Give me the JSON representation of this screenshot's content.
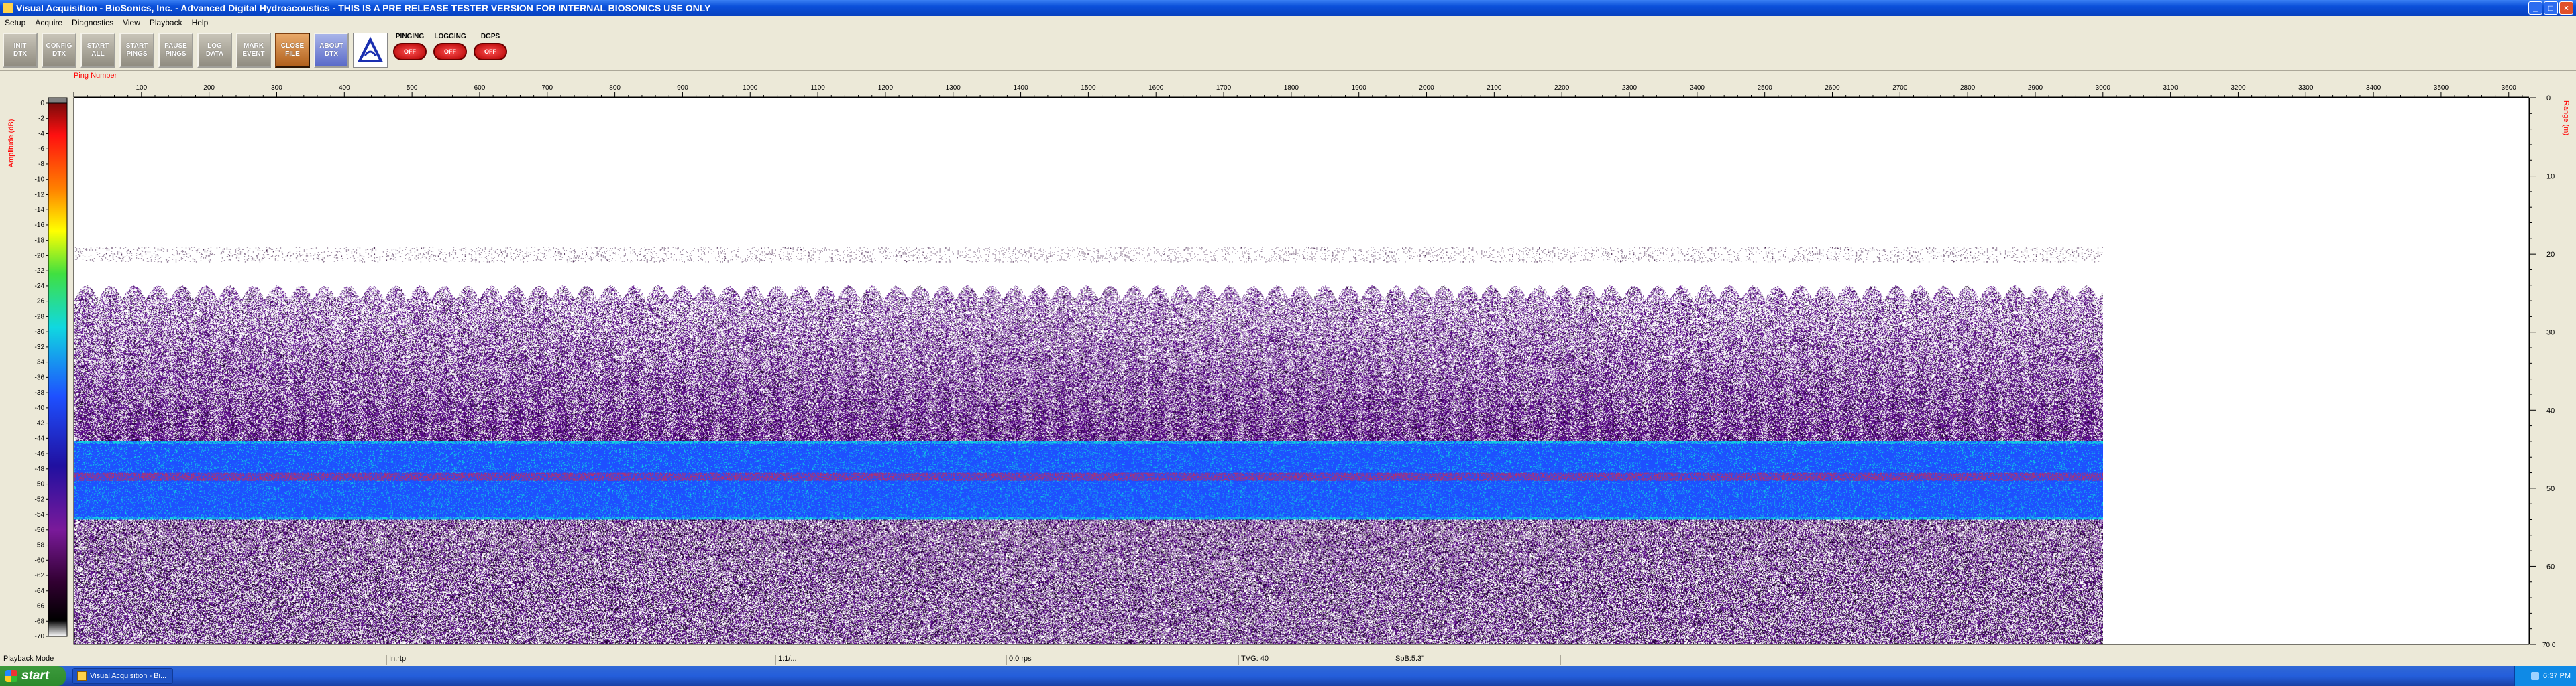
{
  "window": {
    "title": "Visual Acquisition  -  BioSonics, Inc.  -  Advanced Digital Hydroacoustics  -  THIS IS A PRE RELEASE TESTER VERSION FOR INTERNAL BIOSONICS USE ONLY",
    "minimize": "_",
    "maximize": "□",
    "close": "×"
  },
  "menu": [
    "Setup",
    "Acquire",
    "Diagnostics",
    "View",
    "Playback",
    "Help"
  ],
  "toolbar": {
    "buttons": [
      {
        "line1": "INIT",
        "line2": "DTX"
      },
      {
        "line1": "CONFIG",
        "line2": "DTX"
      },
      {
        "line1": "START",
        "line2": "ALL"
      },
      {
        "line1": "START",
        "line2": "PINGS"
      },
      {
        "line1": "PAUSE",
        "line2": "PINGS"
      },
      {
        "line1": "LOG",
        "line2": "DATA"
      },
      {
        "line1": "MARK",
        "line2": "EVENT"
      },
      {
        "line1": "CLOSE",
        "line2": "FILE"
      },
      {
        "line1": "ABOUT",
        "line2": "DTX"
      }
    ],
    "indicators": [
      {
        "label": "PINGING",
        "state": "OFF"
      },
      {
        "label": "LOGGING",
        "state": "OFF"
      },
      {
        "label": "DGPS",
        "state": "OFF"
      }
    ]
  },
  "echogram": {
    "x_axis_label": "Ping Number",
    "x_ticks": [
      100,
      200,
      300,
      400,
      500,
      600,
      700,
      800,
      900,
      1000,
      1100,
      1200,
      1300,
      1400,
      1500,
      1600,
      1700,
      1800,
      1900,
      2000,
      2100,
      2200,
      2300,
      2400,
      2500,
      2600,
      2700,
      2800,
      2900,
      3000,
      3100,
      3200,
      3300,
      3400,
      3500,
      3600
    ],
    "x_range": [
      0,
      3630
    ],
    "pings_recorded": 3000,
    "colorbar_label": "Amplitude (dB)",
    "colorbar_ticks": [
      0,
      -2,
      -4,
      -6,
      -8,
      -10,
      -12,
      -14,
      -16,
      -18,
      -20,
      -22,
      -24,
      -26,
      -28,
      -30,
      -32,
      -34,
      -36,
      -38,
      -40,
      -42,
      -44,
      -46,
      -48,
      -50,
      -52,
      -54,
      -56,
      -58,
      -60,
      -62,
      -64,
      -66,
      -68,
      -70
    ],
    "range_label": "Range (m)",
    "range_ticks": [
      0,
      10,
      20,
      30,
      40,
      50,
      60
    ],
    "range_max_label": "70.0",
    "range_max": 70,
    "colors": {
      "background": "#ffffff",
      "noise": "#5a0a8a",
      "band": "#1e50ff",
      "band_edge": "#10d8e0",
      "band_core": "#b03070",
      "axis_label": "#ff0000"
    }
  },
  "status": {
    "mode": "Playback Mode",
    "pane2": "In.rtp",
    "pane3": "1:1/...",
    "pane4": "0.0 rps",
    "pane5": "TVG: 40",
    "pane6": "SpB:5.3\""
  },
  "taskbar": {
    "start": "start",
    "task_label": "Visual Acquisition - Bi...",
    "clock": "6:37 PM"
  }
}
